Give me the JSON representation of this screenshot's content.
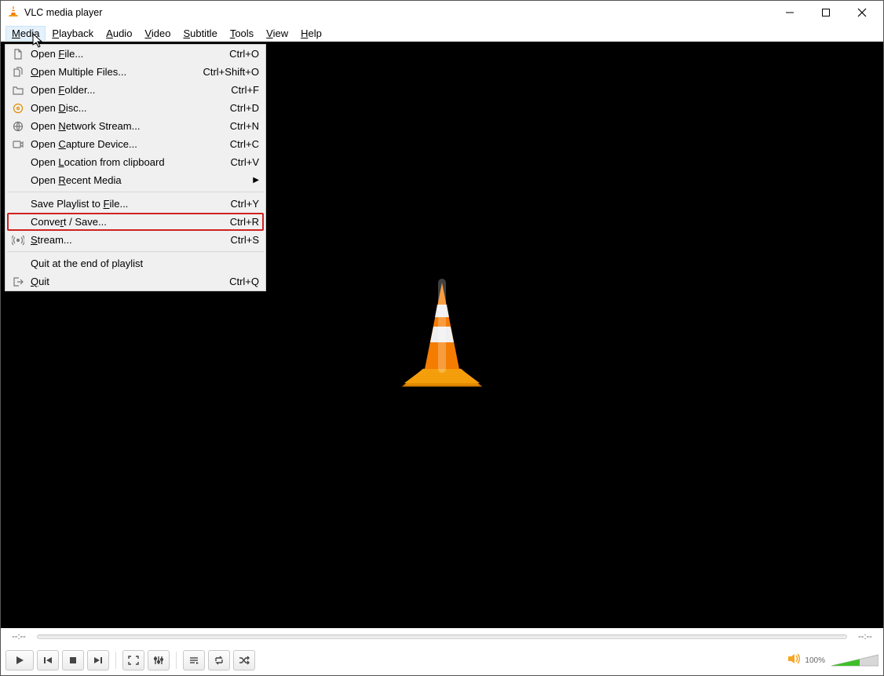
{
  "titlebar": {
    "title": "VLC media player"
  },
  "menubar": {
    "items": [
      {
        "label": "Media",
        "accel": "M"
      },
      {
        "label": "Playback",
        "accel": "P"
      },
      {
        "label": "Audio",
        "accel": "A"
      },
      {
        "label": "Video",
        "accel": "V"
      },
      {
        "label": "Subtitle",
        "accel": "S"
      },
      {
        "label": "Tools",
        "accel": "T"
      },
      {
        "label": "View",
        "accel": "V"
      },
      {
        "label": "Help",
        "accel": "H"
      }
    ]
  },
  "dropdown": {
    "items": [
      {
        "type": "item",
        "icon": "file",
        "label": "Open File...",
        "shortcut": "Ctrl+O"
      },
      {
        "type": "item",
        "icon": "files",
        "label": "Open Multiple Files...",
        "shortcut": "Ctrl+Shift+O"
      },
      {
        "type": "item",
        "icon": "folder",
        "label": "Open Folder...",
        "shortcut": "Ctrl+F"
      },
      {
        "type": "item",
        "icon": "disc",
        "label": "Open Disc...",
        "shortcut": "Ctrl+D"
      },
      {
        "type": "item",
        "icon": "network",
        "label": "Open Network Stream...",
        "shortcut": "Ctrl+N"
      },
      {
        "type": "item",
        "icon": "capture",
        "label": "Open Capture Device...",
        "shortcut": "Ctrl+C"
      },
      {
        "type": "item",
        "icon": "",
        "label": "Open Location from clipboard",
        "shortcut": "Ctrl+V"
      },
      {
        "type": "item",
        "icon": "",
        "label": "Open Recent Media",
        "submenu": true
      },
      {
        "type": "sep"
      },
      {
        "type": "item",
        "icon": "",
        "label": "Save Playlist to File...",
        "shortcut": "Ctrl+Y"
      },
      {
        "type": "item",
        "icon": "",
        "label": "Convert / Save...",
        "shortcut": "Ctrl+R",
        "highlight": true
      },
      {
        "type": "item",
        "icon": "stream",
        "label": "Stream...",
        "shortcut": "Ctrl+S"
      },
      {
        "type": "sep"
      },
      {
        "type": "item",
        "icon": "",
        "label": "Quit at the end of playlist"
      },
      {
        "type": "item",
        "icon": "quit",
        "label": "Quit",
        "shortcut": "Ctrl+Q"
      }
    ]
  },
  "seek": {
    "current": "--:--",
    "total": "--:--"
  },
  "controls": {
    "volume_label": "100%"
  }
}
